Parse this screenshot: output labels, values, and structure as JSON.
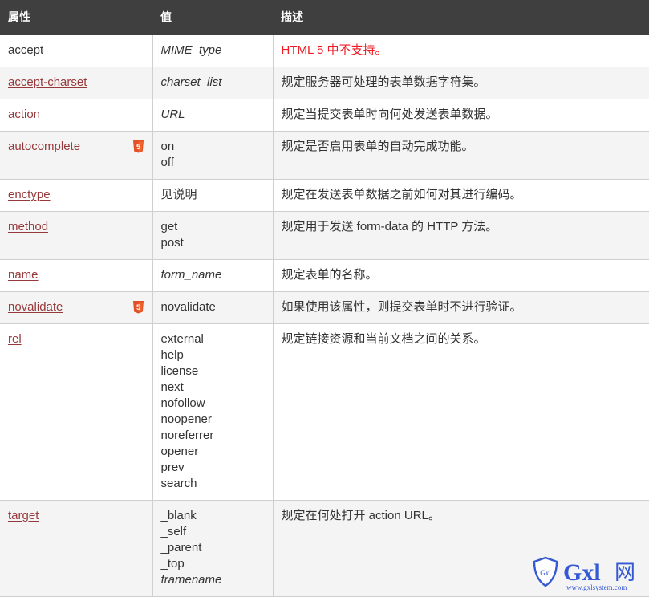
{
  "table": {
    "headers": [
      "属性",
      "值",
      "描述"
    ],
    "rows": [
      {
        "attr": "accept",
        "attr_is_link": false,
        "html5": false,
        "values": [
          {
            "text": "MIME_type",
            "italic": true
          }
        ],
        "desc": "HTML 5 中不支持。",
        "desc_warn": true
      },
      {
        "attr": "accept-charset",
        "attr_is_link": true,
        "html5": false,
        "values": [
          {
            "text": "charset_list",
            "italic": true
          }
        ],
        "desc": "规定服务器可处理的表单数据字符集。",
        "desc_warn": false
      },
      {
        "attr": "action",
        "attr_is_link": true,
        "html5": false,
        "values": [
          {
            "text": "URL",
            "italic": true
          }
        ],
        "desc": "规定当提交表单时向何处发送表单数据。",
        "desc_warn": false
      },
      {
        "attr": "autocomplete",
        "attr_is_link": true,
        "html5": true,
        "values": [
          {
            "text": "on",
            "italic": false
          },
          {
            "text": "off",
            "italic": false
          }
        ],
        "desc": "规定是否启用表单的自动完成功能。",
        "desc_warn": false
      },
      {
        "attr": "enctype",
        "attr_is_link": true,
        "html5": false,
        "values": [
          {
            "text": "见说明",
            "italic": false
          }
        ],
        "desc": "规定在发送表单数据之前如何对其进行编码。",
        "desc_warn": false
      },
      {
        "attr": "method",
        "attr_is_link": true,
        "html5": false,
        "values": [
          {
            "text": "get",
            "italic": false
          },
          {
            "text": "post",
            "italic": false
          }
        ],
        "desc": "规定用于发送 form-data 的 HTTP 方法。",
        "desc_warn": false
      },
      {
        "attr": "name",
        "attr_is_link": true,
        "html5": false,
        "values": [
          {
            "text": "form_name",
            "italic": true
          }
        ],
        "desc": "规定表单的名称。",
        "desc_warn": false
      },
      {
        "attr": "novalidate",
        "attr_is_link": true,
        "html5": true,
        "values": [
          {
            "text": "novalidate",
            "italic": false
          }
        ],
        "desc": "如果使用该属性，则提交表单时不进行验证。",
        "desc_warn": false
      },
      {
        "attr": "rel",
        "attr_is_link": true,
        "html5": false,
        "values": [
          {
            "text": "external",
            "italic": false
          },
          {
            "text": "help",
            "italic": false
          },
          {
            "text": "license",
            "italic": false
          },
          {
            "text": "next",
            "italic": false
          },
          {
            "text": "nofollow",
            "italic": false
          },
          {
            "text": "noopener",
            "italic": false
          },
          {
            "text": "noreferrer",
            "italic": false
          },
          {
            "text": "opener",
            "italic": false
          },
          {
            "text": "prev",
            "italic": false
          },
          {
            "text": "search",
            "italic": false
          }
        ],
        "desc": "规定链接资源和当前文档之间的关系。",
        "desc_warn": false
      },
      {
        "attr": "target",
        "attr_is_link": true,
        "html5": false,
        "values": [
          {
            "text": "_blank",
            "italic": false
          },
          {
            "text": "_self",
            "italic": false
          },
          {
            "text": "_parent",
            "italic": false
          },
          {
            "text": "_top",
            "italic": false
          },
          {
            "text": "framename",
            "italic": true
          }
        ],
        "desc": "规定在何处打开 action URL。",
        "desc_warn": false
      }
    ]
  },
  "watermark": {
    "shield_label": "Gxl",
    "brand": "Gxl",
    "brand_cn": "网",
    "url": "www.gxlsystem.com"
  },
  "colors": {
    "header_bg": "#3f3f3f",
    "header_text": "#ffffff",
    "link": "#97393b",
    "warn_text": "#ef1c25",
    "row_alt_bg": "#f4f4f4",
    "border": "#cfcfcf",
    "html5_badge": "#e34f26",
    "watermark_blue": "#2f55d4"
  },
  "icons": {
    "html5_badge": "html5-badge-icon",
    "shield": "shield-icon"
  }
}
